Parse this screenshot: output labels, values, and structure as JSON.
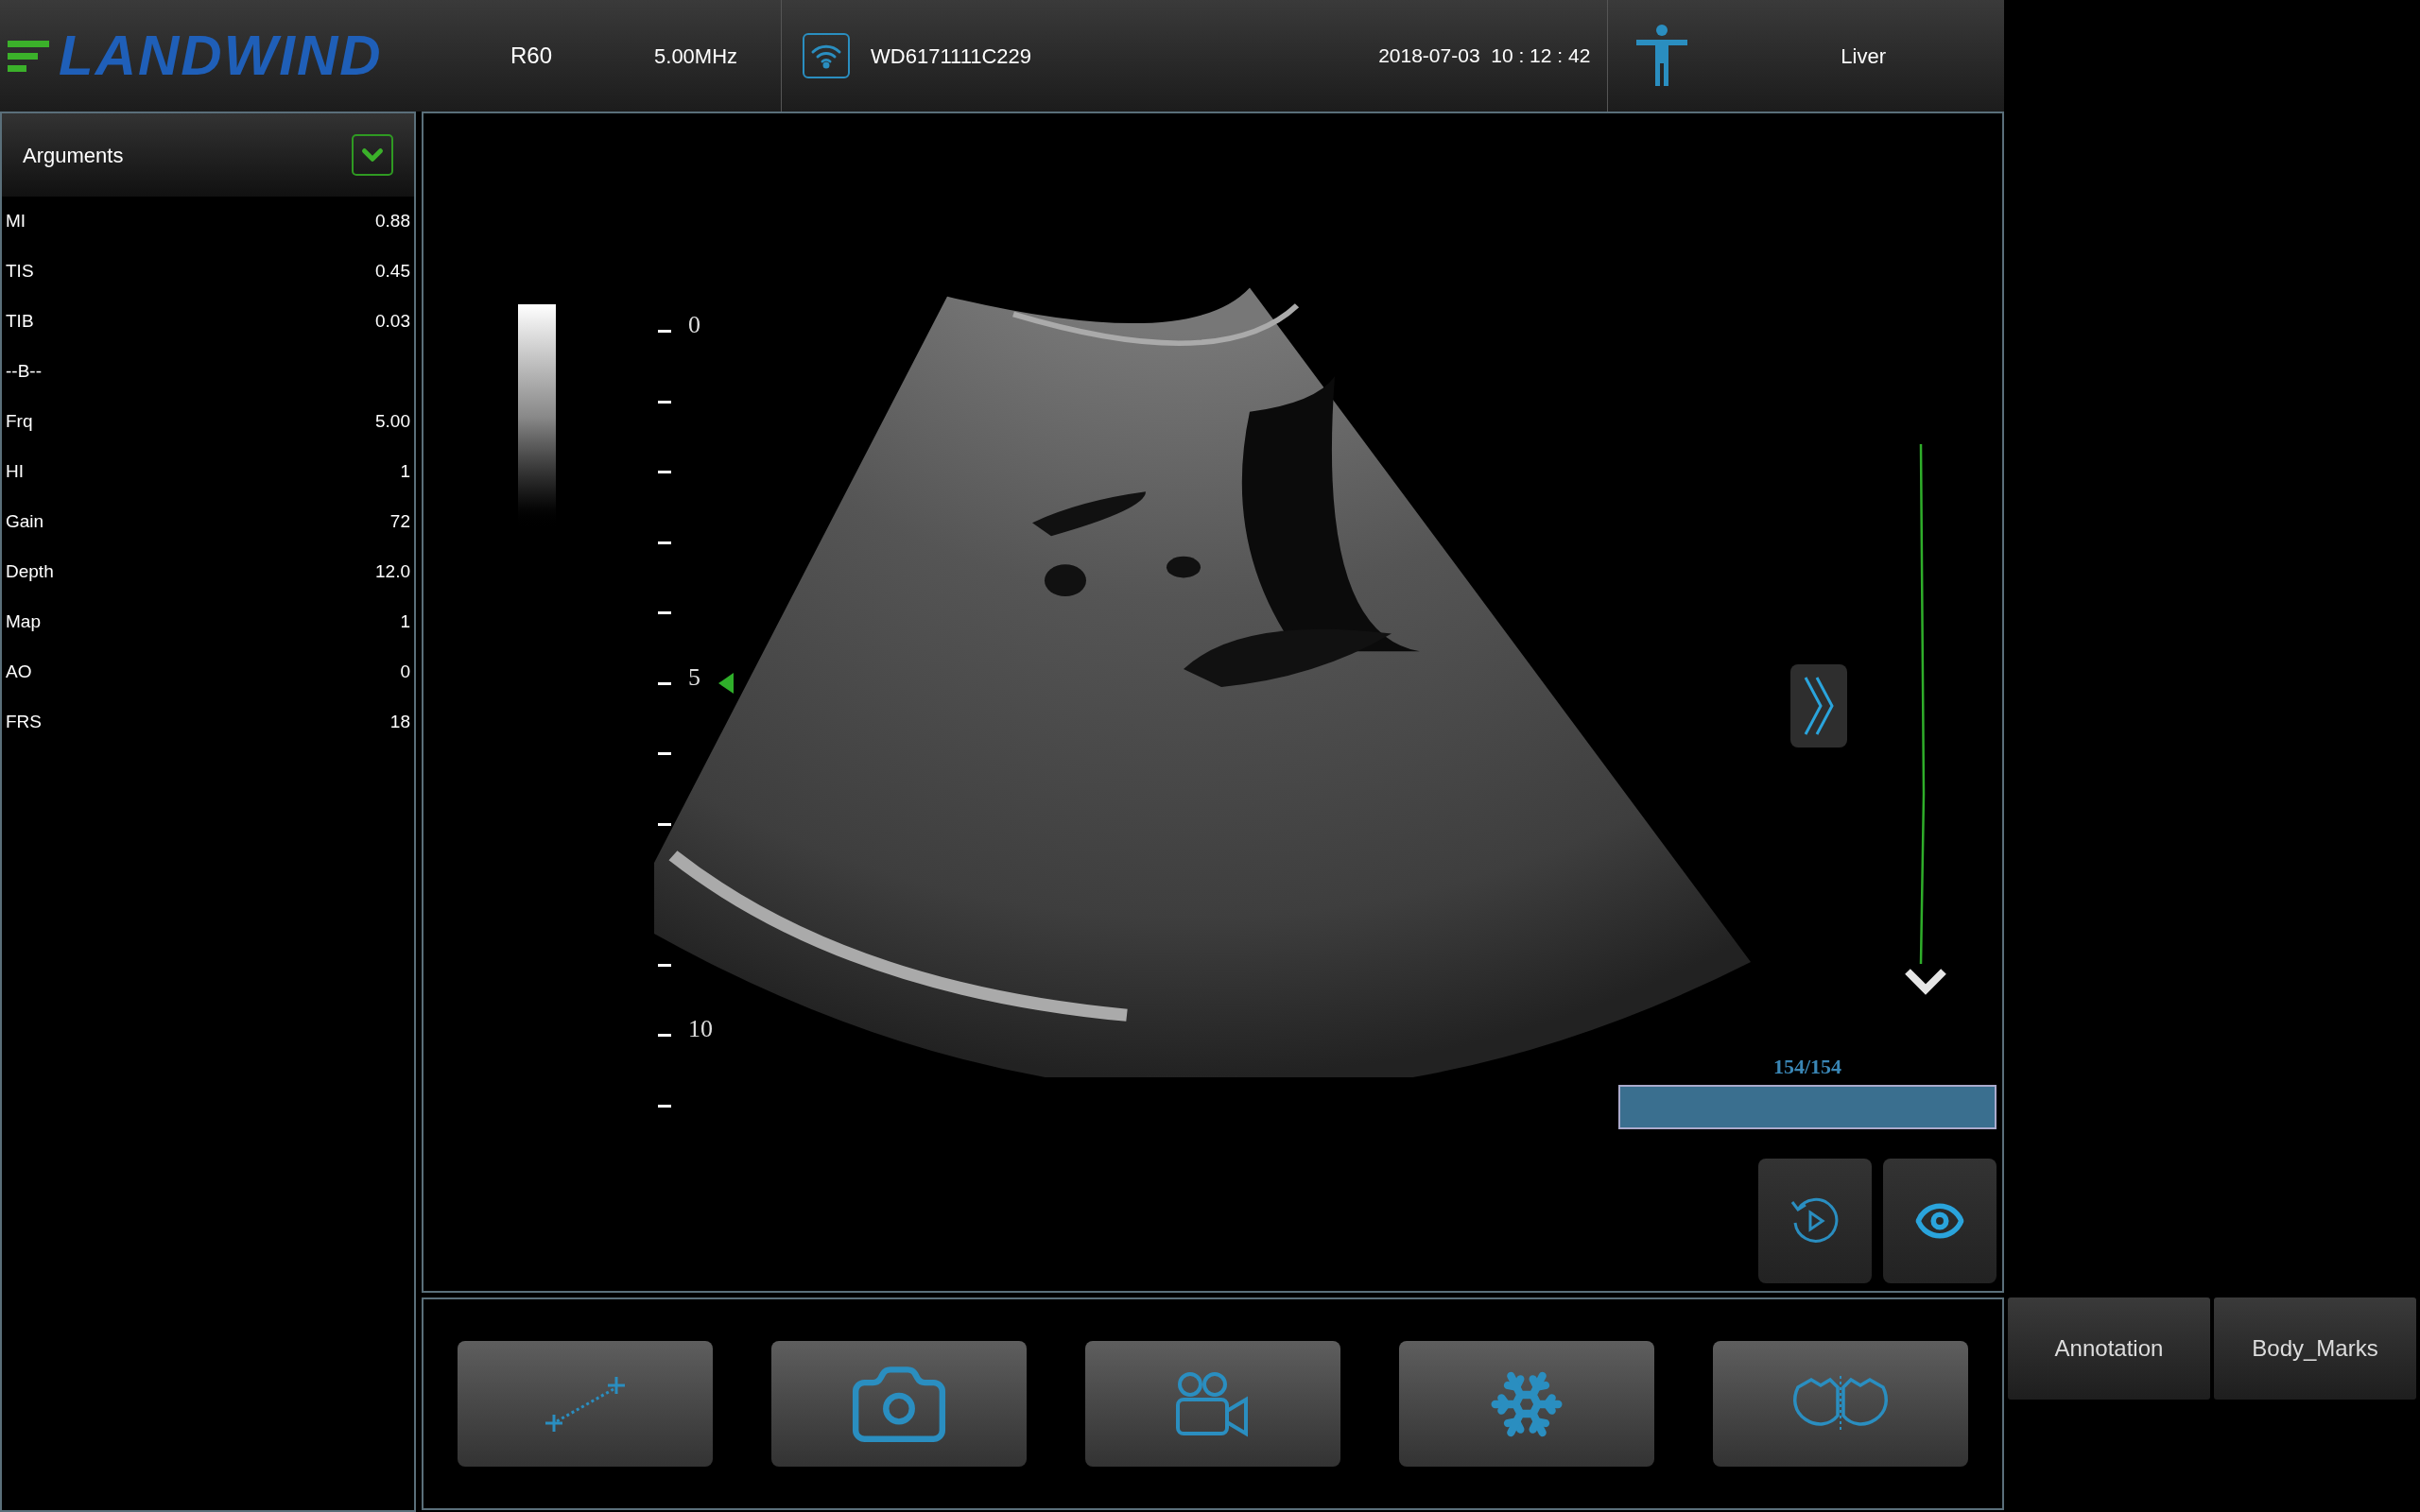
{
  "header": {
    "logo": "LANDWIND",
    "probe": "R60",
    "frequency": "5.00MHz",
    "device_id": "WD6171111C229",
    "datetime": "2018-07-03  10 : 12 : 42",
    "exam": "Liver"
  },
  "arguments_panel": {
    "title": "Arguments",
    "rows": [
      {
        "label": "MI",
        "value": "0.88"
      },
      {
        "label": "TIS",
        "value": "0.45"
      },
      {
        "label": "TIB",
        "value": "0.03"
      },
      {
        "label": "--B--",
        "value": ""
      },
      {
        "label": "Frq",
        "value": "5.00"
      },
      {
        "label": "HI",
        "value": "1"
      },
      {
        "label": "Gain",
        "value": "72"
      },
      {
        "label": "Depth",
        "value": "12.0"
      },
      {
        "label": "Map",
        "value": "1"
      },
      {
        "label": "AO",
        "value": "0"
      },
      {
        "label": "FRS",
        "value": "18"
      }
    ]
  },
  "depth_scale": {
    "labels": [
      "0",
      "5",
      "10"
    ]
  },
  "cine": {
    "reading": "154/154",
    "level": 1
  },
  "tools": [
    {
      "kind": "measure"
    },
    {
      "kind": "camera"
    },
    {
      "kind": "video"
    },
    {
      "kind": "freeze"
    },
    {
      "kind": "bodymark"
    }
  ],
  "side_buttons": [
    "Annotation",
    "Body_Marks"
  ]
}
